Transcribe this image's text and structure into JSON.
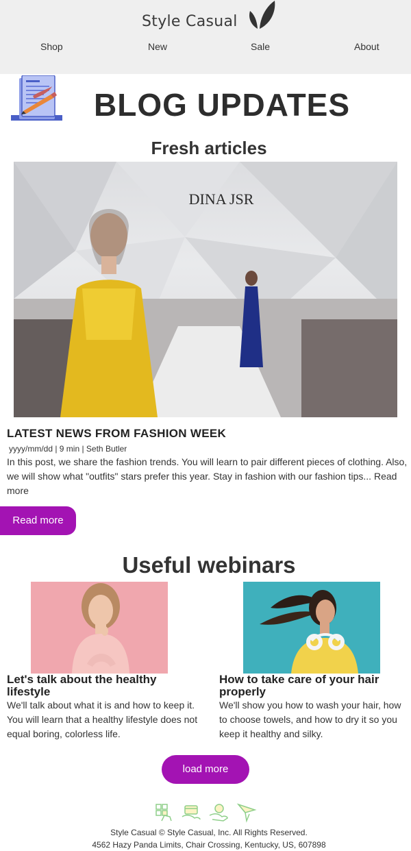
{
  "brand": {
    "name": "Style Casual"
  },
  "nav": [
    "Shop",
    "New",
    "Sale",
    "About"
  ],
  "banner": {
    "title": "BLOG UPDATES"
  },
  "fresh": {
    "section_title": "Fresh articles",
    "hero_sign": "DINA JSR",
    "article": {
      "title": "LATEST NEWS FROM FASHION WEEK",
      "meta": "yyyy/mm/dd | 9 min | Seth Butler",
      "body": "In this post, we share the fashion trends. You will learn to pair different pieces of clothing. Also, we will show what \"outfits\" stars prefer this year. Stay in fashion with our fashion tips...",
      "inline_link": "Read more"
    },
    "button_label": "Read more"
  },
  "webinars": {
    "section_title": "Useful webinars",
    "cards": [
      {
        "title": "Let's talk about the healthy lifestyle",
        "text": "We'll talk about what it is and how to keep it. You will learn that a healthy lifestyle does not equal boring, colorless life."
      },
      {
        "title": "How to take care of your hair properly",
        "text": "We'll show you how to wash your hair, how to choose towels, and how to dry it so you keep it healthy and silky."
      }
    ],
    "load_more_label": "load more"
  },
  "social_icons": [
    "grid-hand-icon",
    "card-hand-icon",
    "money-hand-icon",
    "paper-plane-icon"
  ],
  "footer": {
    "copyright": "Style Casual © Style Casual, Inc. All Rights Reserved.",
    "address": "4562 Hazy Panda Limits, Chair Crossing, Kentucky, US, 607898"
  },
  "colors": {
    "accent": "#a313b3",
    "header_bg": "#efefef"
  }
}
